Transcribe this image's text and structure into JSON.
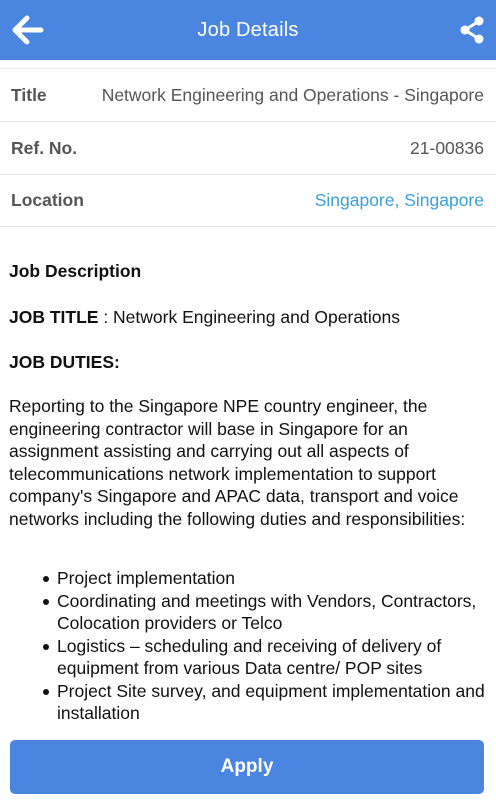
{
  "header": {
    "title": "Job Details",
    "back_icon": "arrow-left-icon",
    "share_icon": "share-icon",
    "color": "#4a86e0"
  },
  "details": [
    {
      "label": "Title",
      "value": "Network Engineering and Operations - Singapore",
      "link": false
    },
    {
      "label": "Ref. No.",
      "value": "21-00836",
      "link": false
    },
    {
      "label": "Location",
      "value": "Singapore, Singapore",
      "link": true,
      "link_color": "#3aa0d8"
    }
  ],
  "description": {
    "heading": "Job Description",
    "job_title_label": "JOB TITLE",
    "job_title_value": " : Network Engineering and Operations",
    "duties_heading": "JOB DUTIES:",
    "paragraph": "Reporting to the Singapore NPE country engineer, the engineering contractor will base in Singapore for an assignment assisting and carrying out all aspects of telecommunications network implementation to support company's Singapore and APAC data, transport and voice networks including the following duties and responsibilities:",
    "duties": [
      "Project implementation",
      "Coordinating and meetings with Vendors, Contractors, Colocation providers or Telco",
      "Logistics – scheduling and receiving of delivery of equipment from various Data centre/ POP sites",
      "Project Site survey, and equipment implementation and installation"
    ]
  },
  "apply_button": {
    "label": "Apply"
  }
}
